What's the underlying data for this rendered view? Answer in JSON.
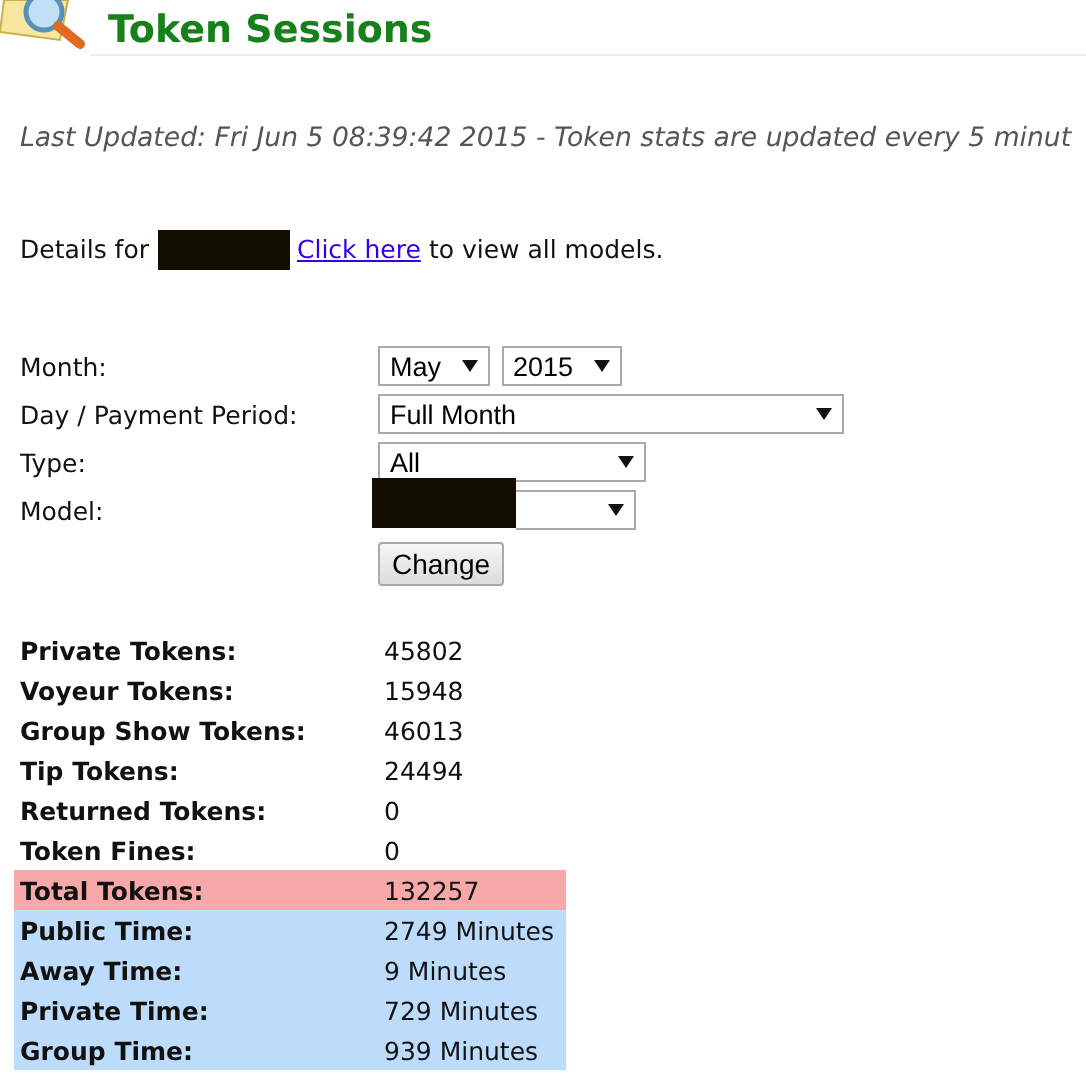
{
  "header": {
    "title": "Token Sessions"
  },
  "notice": "Last Updated: Fri Jun 5 08:39:42 2015 - Token stats are updated every 5 minut",
  "details": {
    "prefix": "Details for",
    "link": "Click here",
    "suffix": "to view all models."
  },
  "form": {
    "rows": [
      {
        "label": "Month:",
        "selects": [
          {
            "value": "May"
          },
          {
            "value": "2015"
          }
        ]
      },
      {
        "label": "Day / Payment Period:",
        "selects": [
          {
            "value": "Full Month"
          }
        ]
      },
      {
        "label": "Type:",
        "selects": [
          {
            "value": "All"
          }
        ]
      },
      {
        "label": "Model:",
        "selects": [
          {
            "redacted": true
          }
        ]
      }
    ],
    "button": "Change"
  },
  "stats": [
    {
      "label": "Private Tokens:",
      "value": "45802"
    },
    {
      "label": "Voyeur Tokens:",
      "value": "15948"
    },
    {
      "label": "Group Show Tokens:",
      "value": "46013"
    },
    {
      "label": "Tip Tokens:",
      "value": "24494"
    },
    {
      "label": "Returned Tokens:",
      "value": "0"
    },
    {
      "label": "Token Fines:",
      "value": "0"
    },
    {
      "label": "Total Tokens:",
      "value": "132257",
      "color": "#f7a8a8"
    },
    {
      "label": "Public Time:",
      "value": "2749 Minutes",
      "color": "#bddcfb"
    },
    {
      "label": "Away Time:",
      "value": "9 Minutes",
      "color": "#bddcfb"
    },
    {
      "label": "Private Time:",
      "value": "729 Minutes",
      "color": "#bddcfb"
    },
    {
      "label": "Group Time:",
      "value": "939 Minutes",
      "color": "#bddcfb"
    }
  ]
}
